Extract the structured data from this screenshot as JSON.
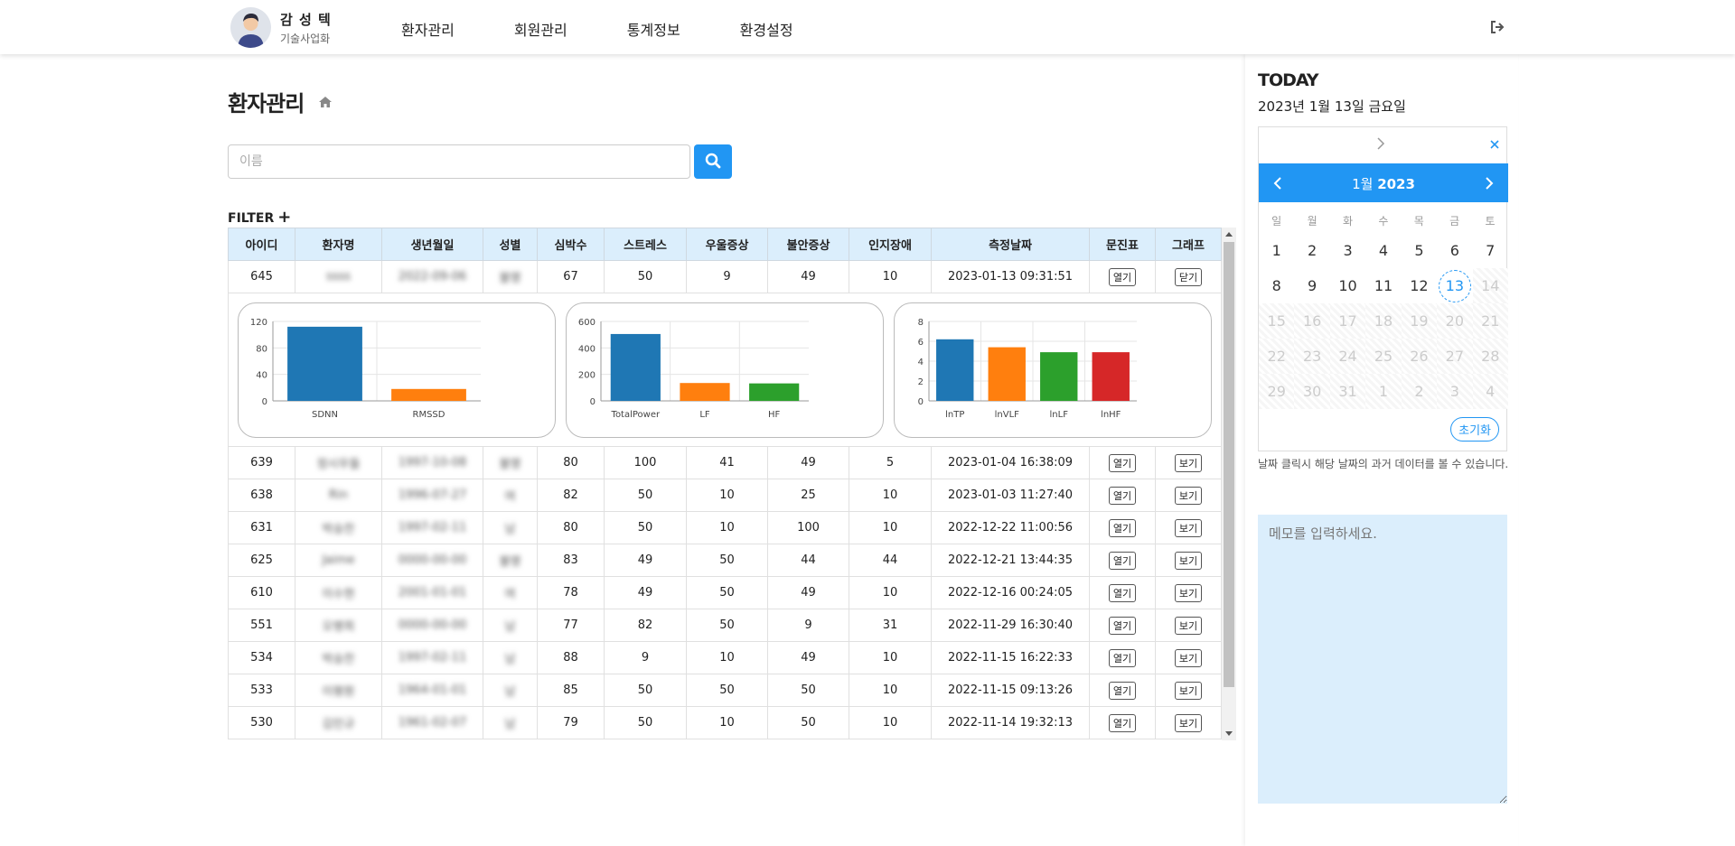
{
  "user": {
    "name": "감 성 텍",
    "org": "기술사업화"
  },
  "nav": [
    "환자관리",
    "회원관리",
    "통계정보",
    "환경설정"
  ],
  "page": {
    "title": "환자관리"
  },
  "search": {
    "placeholder": "이름"
  },
  "filter": {
    "label": "FILTER",
    "plus": "+"
  },
  "table": {
    "headers": [
      "아이디",
      "환자명",
      "생년월일",
      "성별",
      "심박수",
      "스트레스",
      "우울증상",
      "불안증상",
      "인지장애",
      "측정날짜",
      "문진표",
      "그래프"
    ],
    "open_label": "열기",
    "view_label": "보기",
    "close_label": "닫기",
    "rows": [
      {
        "id": "645",
        "name": "ssss",
        "birth": "2022-09-06",
        "gender": "불명",
        "hr": "67",
        "stress": "50",
        "dep": "9",
        "anx": "49",
        "cog": "10",
        "date": "2023-01-13 09:31:51"
      },
      {
        "id": "639",
        "name": "정시우들",
        "birth": "1997-10-08",
        "gender": "불명",
        "hr": "80",
        "stress": "100",
        "dep": "41",
        "anx": "49",
        "cog": "5",
        "date": "2023-01-04 16:38:09"
      },
      {
        "id": "638",
        "name": "Rin",
        "birth": "1996-07-27",
        "gender": "여",
        "hr": "82",
        "stress": "50",
        "dep": "10",
        "anx": "25",
        "cog": "10",
        "date": "2023-01-03 11:27:40"
      },
      {
        "id": "631",
        "name": "박승찬",
        "birth": "1997-02-11",
        "gender": "남",
        "hr": "80",
        "stress": "50",
        "dep": "10",
        "anx": "100",
        "cog": "10",
        "date": "2022-12-22 11:00:56"
      },
      {
        "id": "625",
        "name": "Jaime",
        "birth": "0000-00-00",
        "gender": "불명",
        "hr": "83",
        "stress": "49",
        "dep": "50",
        "anx": "44",
        "cog": "44",
        "date": "2022-12-21 13:44:35"
      },
      {
        "id": "610",
        "name": "이수현",
        "birth": "2001-01-01",
        "gender": "여",
        "hr": "78",
        "stress": "49",
        "dep": "50",
        "anx": "49",
        "cog": "10",
        "date": "2022-12-16 00:24:05"
      },
      {
        "id": "551",
        "name": "오병희",
        "birth": "0000-00-00",
        "gender": "남",
        "hr": "77",
        "stress": "82",
        "dep": "50",
        "anx": "9",
        "cog": "31",
        "date": "2022-11-29 16:30:40"
      },
      {
        "id": "534",
        "name": "박승찬",
        "birth": "1997-02-11",
        "gender": "남",
        "hr": "88",
        "stress": "9",
        "dep": "10",
        "anx": "49",
        "cog": "10",
        "date": "2022-11-15 16:22:33"
      },
      {
        "id": "533",
        "name": "이평원",
        "birth": "1964-01-01",
        "gender": "남",
        "hr": "85",
        "stress": "50",
        "dep": "50",
        "anx": "50",
        "cog": "10",
        "date": "2022-11-15 09:13:26"
      },
      {
        "id": "530",
        "name": "김민규",
        "birth": "1961-02-07",
        "gender": "남",
        "hr": "79",
        "stress": "50",
        "dep": "10",
        "anx": "50",
        "cog": "10",
        "date": "2022-11-14 19:32:13"
      }
    ]
  },
  "chart_data": [
    {
      "type": "bar",
      "categories": [
        "SDNN",
        "RMSSD"
      ],
      "values": [
        112,
        18
      ],
      "colors": [
        "#1f77b4",
        "#ff7f0e"
      ],
      "ylim": [
        0,
        120
      ],
      "yticks": [
        0,
        40,
        80,
        120
      ]
    },
    {
      "type": "bar",
      "categories": [
        "TotalPower",
        "LF",
        "HF"
      ],
      "values": [
        505,
        135,
        132
      ],
      "colors": [
        "#1f77b4",
        "#ff7f0e",
        "#2ca02c"
      ],
      "ylim": [
        0,
        600
      ],
      "yticks": [
        0,
        200,
        400,
        600
      ]
    },
    {
      "type": "bar",
      "categories": [
        "lnTP",
        "lnVLF",
        "lnLF",
        "lnHF"
      ],
      "values": [
        6.2,
        5.4,
        4.9,
        4.9
      ],
      "colors": [
        "#1f77b4",
        "#ff7f0e",
        "#2ca02c",
        "#d62728"
      ],
      "ylim": [
        0,
        8
      ],
      "yticks": [
        0,
        2,
        4,
        6,
        8
      ]
    }
  ],
  "today": {
    "title": "TODAY",
    "date": "2023년 1월 13일 금요일"
  },
  "calendar": {
    "month_label": "1월",
    "year_label": "2023",
    "dows": [
      "일",
      "월",
      "화",
      "수",
      "목",
      "금",
      "토"
    ],
    "days": [
      {
        "d": "1",
        "s": ""
      },
      {
        "d": "2",
        "s": ""
      },
      {
        "d": "3",
        "s": ""
      },
      {
        "d": "4",
        "s": ""
      },
      {
        "d": "5",
        "s": ""
      },
      {
        "d": "6",
        "s": ""
      },
      {
        "d": "7",
        "s": ""
      },
      {
        "d": "8",
        "s": ""
      },
      {
        "d": "9",
        "s": ""
      },
      {
        "d": "10",
        "s": ""
      },
      {
        "d": "11",
        "s": ""
      },
      {
        "d": "12",
        "s": ""
      },
      {
        "d": "13",
        "s": "today"
      },
      {
        "d": "14",
        "s": "dis"
      },
      {
        "d": "15",
        "s": "dis"
      },
      {
        "d": "16",
        "s": "dis"
      },
      {
        "d": "17",
        "s": "dis"
      },
      {
        "d": "18",
        "s": "dis"
      },
      {
        "d": "19",
        "s": "dis"
      },
      {
        "d": "20",
        "s": "dis"
      },
      {
        "d": "21",
        "s": "dis"
      },
      {
        "d": "22",
        "s": "dis"
      },
      {
        "d": "23",
        "s": "dis"
      },
      {
        "d": "24",
        "s": "dis"
      },
      {
        "d": "25",
        "s": "dis"
      },
      {
        "d": "26",
        "s": "dis"
      },
      {
        "d": "27",
        "s": "dis"
      },
      {
        "d": "28",
        "s": "dis"
      },
      {
        "d": "29",
        "s": "dis"
      },
      {
        "d": "30",
        "s": "dis"
      },
      {
        "d": "31",
        "s": "dis"
      },
      {
        "d": "1",
        "s": "dis"
      },
      {
        "d": "2",
        "s": "dis"
      },
      {
        "d": "3",
        "s": "dis"
      },
      {
        "d": "4",
        "s": "dis"
      }
    ],
    "reset_label": "초기화",
    "note": "날짜 클릭시 해당 날짜의 과거 데이터를 볼 수 있습니다."
  },
  "memo": {
    "placeholder": "메모를 입력하세요."
  },
  "colors": {
    "accent": "#2196f3",
    "header_bg": "#dbeefc",
    "memo_bg": "#dbeefc"
  }
}
